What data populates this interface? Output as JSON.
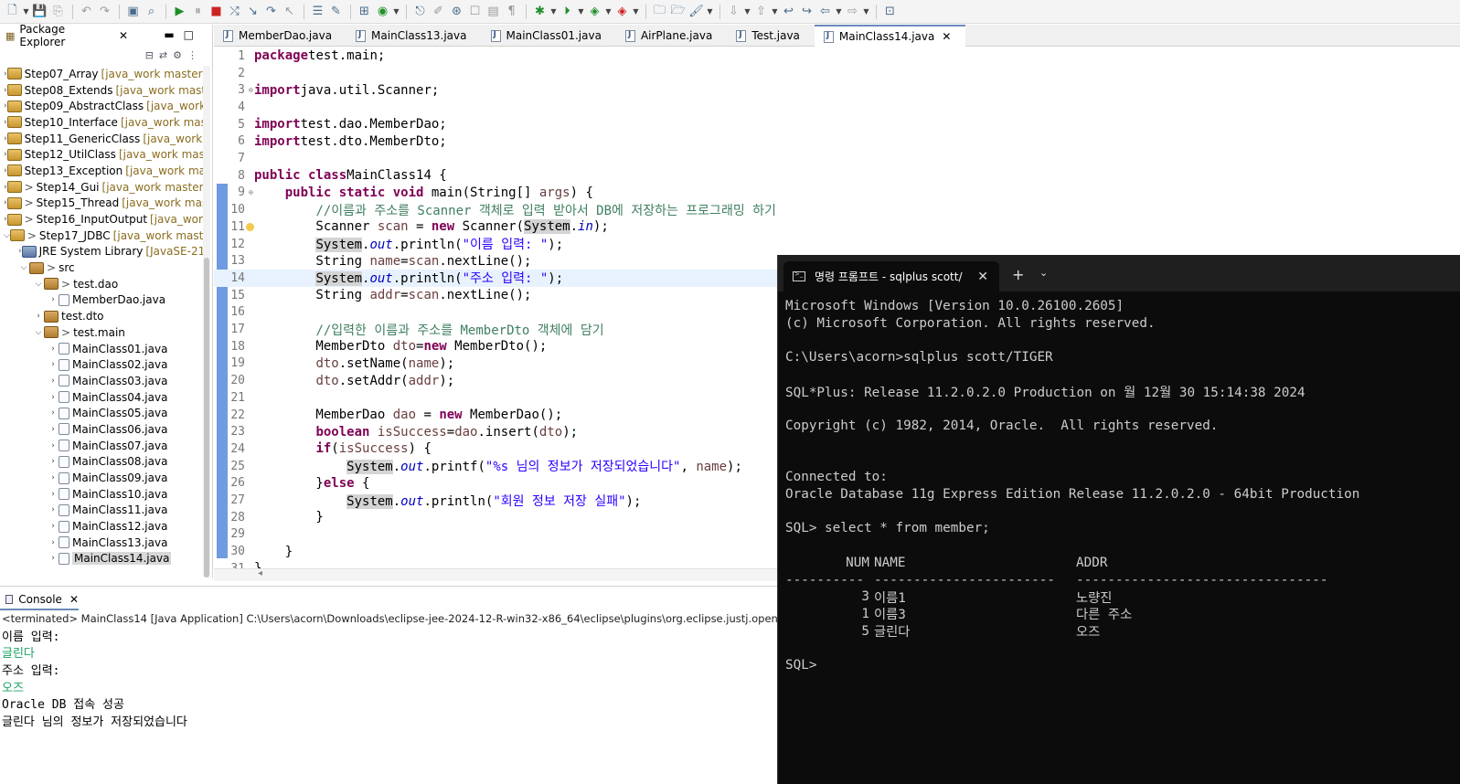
{
  "explorer": {
    "title": "Package Explorer",
    "tree": [
      {
        "arrow": ">",
        "icon": "proj",
        "name": "Step07_Array",
        "branch": "[java_work master]"
      },
      {
        "arrow": ">",
        "icon": "proj",
        "name": "Step08_Extends",
        "branch": "[java_work maste"
      },
      {
        "arrow": ">",
        "icon": "proj",
        "name": "Step09_AbstractClass",
        "branch": "[java_work"
      },
      {
        "arrow": ">",
        "icon": "proj",
        "name": "Step10_Interface",
        "branch": "[java_work mast"
      },
      {
        "arrow": ">",
        "icon": "proj",
        "name": "Step11_GenericClass",
        "branch": "[java_work r"
      },
      {
        "arrow": ">",
        "icon": "proj",
        "name": "Step12_UtilClass",
        "branch": "[java_work mast"
      },
      {
        "arrow": ">",
        "icon": "proj",
        "name": "Step13_Exception",
        "branch": "[java_work mas"
      },
      {
        "arrow": ">",
        "icon": "proj",
        "prefix": ">",
        "name": "Step14_Gui",
        "branch": "[java_work master]"
      },
      {
        "arrow": ">",
        "icon": "proj",
        "prefix": ">",
        "name": "Step15_Thread",
        "branch": "[java_work master"
      },
      {
        "arrow": ">",
        "icon": "proj",
        "prefix": ">",
        "name": "Step16_InputOutput",
        "branch": "[java_work"
      },
      {
        "arrow": "v",
        "icon": "proj",
        "prefix": ">",
        "name": "Step17_JDBC",
        "branch": "[java_work maste"
      },
      {
        "arrow": ">",
        "icon": "lib",
        "name": "JRE System Library",
        "branch": "[JavaSE-21",
        "indent": 1
      },
      {
        "arrow": "v",
        "icon": "pkg",
        "prefix": ">",
        "name": "src",
        "indent": 1
      },
      {
        "arrow": "v",
        "icon": "pkg",
        "prefix": ">",
        "name": "test.dao",
        "indent": 2
      },
      {
        "arrow": ">",
        "icon": "java",
        "name": "MemberDao.java",
        "indent": 3
      },
      {
        "arrow": ">",
        "icon": "pkg",
        "name": "test.dto",
        "indent": 2
      },
      {
        "arrow": "v",
        "icon": "pkg",
        "prefix": ">",
        "name": "test.main",
        "indent": 2
      },
      {
        "arrow": ">",
        "icon": "java",
        "name": "MainClass01.java",
        "indent": 3
      },
      {
        "arrow": ">",
        "icon": "java",
        "name": "MainClass02.java",
        "indent": 3
      },
      {
        "arrow": ">",
        "icon": "java",
        "name": "MainClass03.java",
        "indent": 3
      },
      {
        "arrow": ">",
        "icon": "java",
        "name": "MainClass04.java",
        "indent": 3
      },
      {
        "arrow": ">",
        "icon": "java",
        "name": "MainClass05.java",
        "indent": 3
      },
      {
        "arrow": ">",
        "icon": "java",
        "name": "MainClass06.java",
        "indent": 3
      },
      {
        "arrow": ">",
        "icon": "java",
        "name": "MainClass07.java",
        "indent": 3
      },
      {
        "arrow": ">",
        "icon": "java",
        "name": "MainClass08.java",
        "indent": 3
      },
      {
        "arrow": ">",
        "icon": "java",
        "name": "MainClass09.java",
        "indent": 3
      },
      {
        "arrow": ">",
        "icon": "java",
        "name": "MainClass10.java",
        "indent": 3
      },
      {
        "arrow": ">",
        "icon": "java",
        "name": "MainClass11.java",
        "indent": 3
      },
      {
        "arrow": ">",
        "icon": "java",
        "name": "MainClass12.java",
        "indent": 3
      },
      {
        "arrow": ">",
        "icon": "java",
        "name": "MainClass13.java",
        "indent": 3
      },
      {
        "arrow": ">",
        "icon": "java",
        "name": "MainClass14.java",
        "indent": 3,
        "selected": true
      }
    ]
  },
  "editor": {
    "tabs": [
      {
        "label": "MemberDao.java"
      },
      {
        "label": "MainClass13.java"
      },
      {
        "label": "MainClass01.java"
      },
      {
        "label": "AirPlane.java"
      },
      {
        "label": "Test.java"
      },
      {
        "label": "MainClass14.java",
        "active": true
      }
    ],
    "lines": [
      [
        [
          "kw",
          "package"
        ],
        [
          "",
          "test.main;"
        ]
      ],
      [],
      [
        [
          "kw",
          "import"
        ],
        [
          "",
          "java.util.Scanner;"
        ]
      ],
      [],
      [
        [
          "kw",
          "import"
        ],
        [
          "",
          "test.dao.MemberDao;"
        ]
      ],
      [
        [
          "kw",
          "import"
        ],
        [
          "",
          "test.dto.MemberDto;"
        ]
      ],
      [],
      [
        [
          "kw",
          "public class"
        ],
        [
          "",
          "MainClass14 {"
        ]
      ],
      [
        [
          "",
          "    "
        ],
        [
          "kw",
          "public static void"
        ],
        [
          "",
          " main(String[] "
        ],
        [
          "var",
          "args"
        ],
        [
          "",
          ") {"
        ]
      ],
      [
        [
          "",
          "        "
        ],
        [
          "cm",
          "//이름과 주소를 Scanner 객체로 입력 받아서 DB에 저장하는 프로그래밍 하기"
        ]
      ],
      [
        [
          "",
          "        Scanner "
        ],
        [
          "var",
          "scan"
        ],
        [
          "",
          " = "
        ],
        [
          "kw",
          "new"
        ],
        [
          "",
          " Scanner("
        ],
        [
          "hl",
          "System"
        ],
        [
          "",
          "."
        ],
        [
          "fld",
          "in"
        ],
        [
          "",
          ");"
        ]
      ],
      [
        [
          "",
          "        "
        ],
        [
          "hl",
          "System"
        ],
        [
          "",
          "."
        ],
        [
          "fld",
          "out"
        ],
        [
          "",
          ".println("
        ],
        [
          "str",
          "\"이름 입력: \""
        ],
        [
          "",
          ");"
        ]
      ],
      [
        [
          "",
          "        String "
        ],
        [
          "var",
          "name"
        ],
        [
          "",
          "="
        ],
        [
          "var",
          "scan"
        ],
        [
          "",
          ".nextLine();"
        ]
      ],
      [
        [
          "",
          "        "
        ],
        [
          "hl",
          "System"
        ],
        [
          "",
          "."
        ],
        [
          "fld",
          "out"
        ],
        [
          "",
          ".println("
        ],
        [
          "str",
          "\"주소 입력: \""
        ],
        [
          "",
          ");"
        ]
      ],
      [
        [
          "",
          "        String "
        ],
        [
          "var",
          "addr"
        ],
        [
          "",
          "="
        ],
        [
          "var",
          "scan"
        ],
        [
          "",
          ".nextLine();"
        ]
      ],
      [],
      [
        [
          "",
          "        "
        ],
        [
          "cm",
          "//입력한 이름과 주소를 MemberDto 객체에 담기"
        ]
      ],
      [
        [
          "",
          "        MemberDto "
        ],
        [
          "var",
          "dto"
        ],
        [
          "",
          "="
        ],
        [
          "kw",
          "new"
        ],
        [
          "",
          " MemberDto();"
        ]
      ],
      [
        [
          "",
          "        "
        ],
        [
          "var",
          "dto"
        ],
        [
          "",
          ".setName("
        ],
        [
          "var",
          "name"
        ],
        [
          "",
          ");"
        ]
      ],
      [
        [
          "",
          "        "
        ],
        [
          "var",
          "dto"
        ],
        [
          "",
          ".setAddr("
        ],
        [
          "var",
          "addr"
        ],
        [
          "",
          ");"
        ]
      ],
      [],
      [
        [
          "",
          "        MemberDao "
        ],
        [
          "var",
          "dao"
        ],
        [
          "",
          " = "
        ],
        [
          "kw",
          "new"
        ],
        [
          "",
          " MemberDao();"
        ]
      ],
      [
        [
          "",
          "        "
        ],
        [
          "kw",
          "boolean"
        ],
        [
          "",
          ""
        ],
        [
          "var",
          " isSuccess"
        ],
        [
          "",
          "="
        ],
        [
          "var",
          "dao"
        ],
        [
          "",
          ".insert("
        ],
        [
          "var",
          "dto"
        ],
        [
          "",
          ");"
        ]
      ],
      [
        [
          "",
          "        "
        ],
        [
          "kw",
          "if"
        ],
        [
          "",
          "("
        ],
        [
          "var",
          "isSuccess"
        ],
        [
          "",
          ") {"
        ]
      ],
      [
        [
          "",
          "            "
        ],
        [
          "hl",
          "System"
        ],
        [
          "",
          "."
        ],
        [
          "fld",
          "out"
        ],
        [
          "",
          ".printf("
        ],
        [
          "str",
          "\"%s 님의 정보가 저장되었습니다\""
        ],
        [
          "",
          ", "
        ],
        [
          "var",
          "name"
        ],
        [
          "",
          ");"
        ]
      ],
      [
        [
          "",
          "        }"
        ],
        [
          "kw",
          "else"
        ],
        [
          "",
          " {"
        ]
      ],
      [
        [
          "",
          "            "
        ],
        [
          "hl",
          "System"
        ],
        [
          "",
          "."
        ],
        [
          "fld",
          "out"
        ],
        [
          "",
          ".println("
        ],
        [
          "str",
          "\"회원 정보 저장 실패\""
        ],
        [
          "",
          ");"
        ]
      ],
      [
        [
          "",
          "        }"
        ]
      ],
      [],
      [
        [
          "",
          "    }"
        ]
      ],
      [
        [
          "",
          "}"
        ]
      ]
    ]
  },
  "console": {
    "tab_label": "Console",
    "status": "<terminated> MainClass14 [Java Application] C:\\Users\\acorn\\Downloads\\eclipse-jee-2024-12-R-win32-x86_64\\eclipse\\plugins\\org.eclipse.justj.openjdk.hot",
    "lines": [
      {
        "text": "이름 입력:",
        "input": false
      },
      {
        "text": "글린다",
        "input": true
      },
      {
        "text": "주소 입력:",
        "input": false
      },
      {
        "text": "오즈",
        "input": true
      },
      {
        "text": "Oracle DB 접속 성공",
        "input": false
      },
      {
        "text": "글린다 님의 정보가 저장되었습니다",
        "input": false
      }
    ]
  },
  "terminal": {
    "tab_title": "명령 프롬프트 - sqlplus  scott/",
    "lines": [
      "Microsoft Windows [Version 10.0.26100.2605]",
      "(c) Microsoft Corporation. All rights reserved.",
      "",
      "C:\\Users\\acorn>sqlplus scott/TIGER",
      "",
      "SQL*Plus: Release 11.2.0.2.0 Production on 월 12월 30 15:14:38 2024",
      "",
      "Copyright (c) 1982, 2014, Oracle.  All rights reserved.",
      "",
      "",
      "Connected to:",
      "Oracle Database 11g Express Edition Release 11.2.0.2.0 - 64bit Production",
      "",
      "SQL> select * from member;"
    ],
    "table": {
      "headers": [
        "NUM",
        "NAME",
        "ADDR"
      ],
      "separators": [
        "----------",
        "-----------------------",
        "--------------------------------"
      ],
      "rows": [
        [
          "3",
          "이름1",
          "노량진"
        ],
        [
          "1",
          "이름3",
          "다른 주소"
        ],
        [
          "5",
          "글린다",
          "오즈"
        ]
      ]
    },
    "prompt": "SQL>"
  }
}
